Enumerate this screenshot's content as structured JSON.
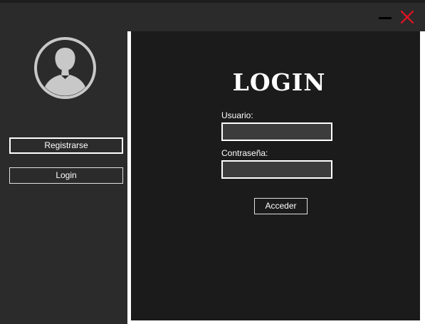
{
  "window": {
    "minimize_icon": "minimize-icon",
    "close_icon": "close-icon",
    "close_color": "#e81123"
  },
  "sidebar": {
    "avatar_icon": "user-avatar-icon",
    "register_label": "Registrarse",
    "login_label": "Login"
  },
  "login_form": {
    "title": "LOGIN",
    "username_label": "Usuario:",
    "username_value": "",
    "password_label": "Contraseña:",
    "password_value": "",
    "submit_label": "Acceder"
  }
}
